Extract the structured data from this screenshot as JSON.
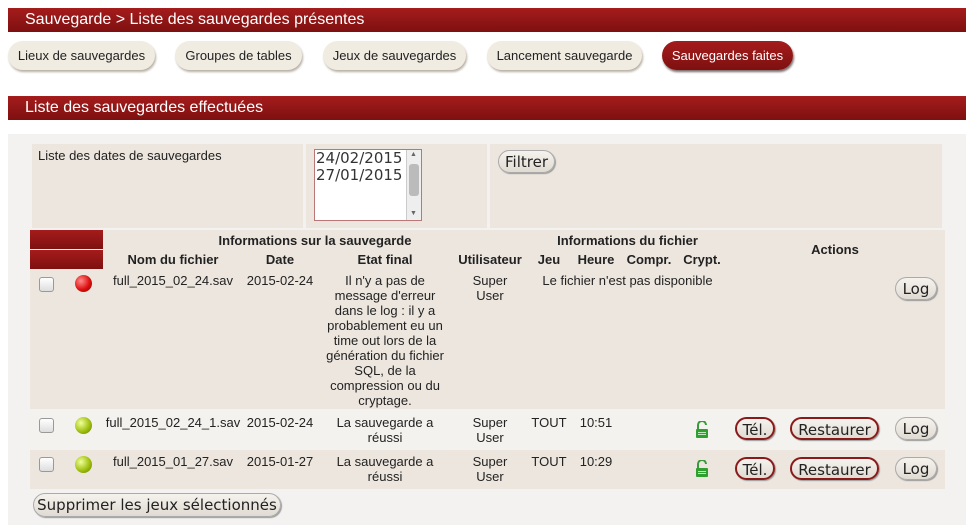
{
  "header": {
    "breadcrumb": "Sauvegarde > Liste des sauvegardes présentes"
  },
  "tabs": [
    {
      "label": "Lieux de sauvegardes"
    },
    {
      "label": "Groupes de tables"
    },
    {
      "label": "Jeux de sauvegardes"
    },
    {
      "label": "Lancement sauvegarde"
    },
    {
      "label": "Sauvegardes faites"
    }
  ],
  "section": {
    "title": "Liste des sauvegardes effectuées"
  },
  "filter": {
    "label": "Liste des dates de sauvegardes",
    "dates": [
      "24/02/2015",
      "27/01/2015"
    ],
    "button": "Filtrer"
  },
  "table": {
    "group_backup": "Informations sur la sauvegarde",
    "group_file": "Informations du fichier",
    "actions": "Actions",
    "col_file": "Nom du fichier",
    "col_date": "Date",
    "col_state": "Etat final",
    "col_user": "Utilisateur",
    "col_set": "Jeu",
    "col_time": "Heure",
    "col_compr": "Compr.",
    "col_crypt": "Crypt.",
    "rows": [
      {
        "status": "red",
        "file": "full_2015_02_24.sav",
        "date": "2015-02-24",
        "state": "Il n'y a pas de message d'erreur dans le log : il y a probablement eu un time out lors de la génération du fichier SQL, de la compression ou du cryptage.",
        "user": "Super User",
        "file_info": "Le fichier n'est pas disponible",
        "log": "Log"
      },
      {
        "status": "green",
        "file": "full_2015_02_24_1.sav",
        "date": "2015-02-24",
        "state": "La sauvegarde a réussi",
        "user": "Super User",
        "set": "TOUT",
        "time": "10:51",
        "download": "Tél.",
        "restore": "Restaurer",
        "log": "Log"
      },
      {
        "status": "green",
        "file": "full_2015_01_27.sav",
        "date": "2015-01-27",
        "state": "La sauvegarde a réussi",
        "user": "Super User",
        "set": "TOUT",
        "time": "10:29",
        "download": "Tél.",
        "restore": "Restaurer",
        "log": "Log"
      }
    ]
  },
  "delete_button": "Supprimer les jeux sélectionnés"
}
